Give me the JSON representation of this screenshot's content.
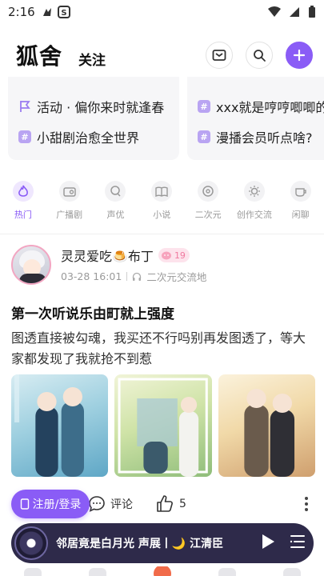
{
  "status_bar": {
    "time": "2:16"
  },
  "header": {
    "brand": "狐舍",
    "follow_tab": "关注"
  },
  "topics": {
    "left": [
      {
        "text": "活动 · 偏你来时就逢春",
        "icon": "flag-icon"
      },
      {
        "text": "小甜剧治愈全世界",
        "icon": "hashtag-icon"
      }
    ],
    "right": [
      {
        "text": "xxx就是哼哼唧唧的",
        "icon": "hashtag-icon"
      },
      {
        "text": "漫播会员听点啥?",
        "icon": "hashtag-icon"
      }
    ]
  },
  "categories": [
    {
      "label": "热门",
      "icon": "flame-icon",
      "active": true
    },
    {
      "label": "广播剧",
      "icon": "radio-icon"
    },
    {
      "label": "声优",
      "icon": "voice-icon"
    },
    {
      "label": "小说",
      "icon": "book-icon"
    },
    {
      "label": "二次元",
      "icon": "anime-icon"
    },
    {
      "label": "创作交流",
      "icon": "bulb-icon"
    },
    {
      "label": "闲聊",
      "icon": "cup-icon"
    }
  ],
  "post": {
    "username": "灵灵爱吃🍮布丁",
    "level": "19",
    "time": "03-28 16:01",
    "channel": "二次元交流地",
    "title": "第一次听说乐由町就上强度",
    "body": "图透直接被勾魂，我买还不行吗别再发图透了，等大家都发现了我就抢不到惹",
    "comment_label": "评论",
    "like_count": "5"
  },
  "login_button": "注册/登录",
  "player": {
    "title": "邻居竟是白月光 声展丨🌙 江清臣"
  },
  "colors": {
    "accent": "#8a5cf6",
    "player_bg": "#2e2a4a"
  }
}
